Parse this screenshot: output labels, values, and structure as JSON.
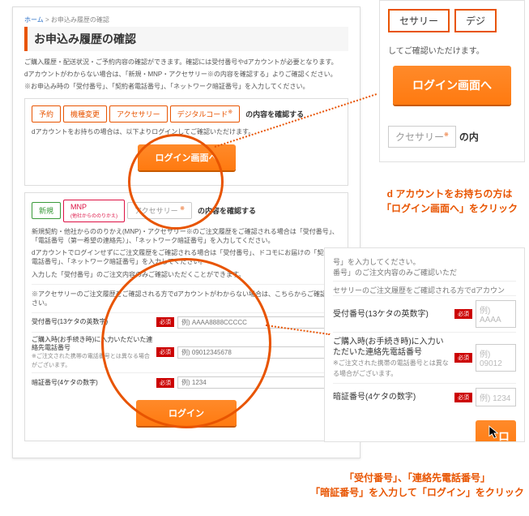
{
  "breadcrumb": {
    "home": "ホーム",
    "sep": " > ",
    "current": "お申込み履歴の確認"
  },
  "page_title": "お申込み履歴の確認",
  "desc1": "ご購入履歴・配送状況・ご予約内容の確認ができます。確認には受付番号やdアカウントが必要となります。",
  "desc2": "dアカウントがわからない場合は、「新規・MNP・アクセサリー※の内容を確認する」よりご確認ください。",
  "desc3": "※お申込み時の「受付番号」、「契約者電話番号」、「ネットワーク暗証番号」を入力してください。",
  "section1": {
    "tabs": [
      "予約",
      "機種変更",
      "アクセサリー",
      "デジタルコード"
    ],
    "tabs_suffix": "※",
    "tabs_label": "の内容を確認する",
    "note": "dアカウントをお持ちの場合は、以下よりログインしてご確認いただけます。",
    "btn": "ログイン画面へ"
  },
  "section2": {
    "tabs": [
      "新規",
      "MNP",
      "アクセサリー"
    ],
    "mnp_sub": "(他社からののりかえ)",
    "tabs_suffix": "※",
    "tabs_label": "の内容を確認する",
    "note1": "新規契約・他社からののりかえ(MNP)・アクセサリー※のご注文履歴をご確認される場合は「受付番号」、「電話番号（第一希望の連絡先）」、「ネットワーク暗証番号」を入力してください。",
    "note2": "dアカウントでログインせずにご注文履歴をご確認される場合は「受付番号」、ドコモにお届けの「契約者電話番号」、「ネットワーク暗証番号」を入力してください。",
    "note3": "入力した「受付番号」のご注文内容のみご確認いただくことができます。",
    "divider_note": "※アクセサリーのご注文履歴をご確認される方でdアカウントがわからない場合は、こちらからご確認ください。",
    "field1_label": "受付番号(13ケタの英数字)",
    "field1_ph": "例) AAAA8888CCCCC",
    "field2_label": "ご購入時(お手続き時)に入力いただいた連絡先電話番号",
    "field2_sub": "※ご注文された携帯の電話番号とは異なる場合がございます。",
    "field2_ph": "例) 09012345678",
    "field3_label": "暗証番号(4ケタの数字)",
    "field3_ph": "例) 1234",
    "req": "必須",
    "login_btn": "ログイン"
  },
  "zoom1": {
    "tab1": "セサリー",
    "tab2": "デジ",
    "note": "してご確認いただけます。",
    "btn": "ログイン画面へ",
    "lower_tab": "クセサリー",
    "lower_suffix": "※",
    "lower_label": "の内"
  },
  "caption1_l1": "d アカウントをお持ちの方は",
  "caption1_l2": "「ログイン画面へ」をクリック",
  "zoom2": {
    "top_frag1": "号」を入力してください。",
    "top_frag2": "番号」のご注文内容のみご確認いただ",
    "top_frag3": "セサリーのご注文履歴をご確認される方でdアカウン",
    "f1": "受付番号(13ケタの英数字)",
    "f1_ph": "例) AAAA",
    "f2": "ご購入時(お手続き時)に入力いただいた連絡先電話番号",
    "f2_sub": "※ご注文された携帯の電話番号とは異なる場合がございます。",
    "f2_ph": "例) 09012",
    "f3": "暗証番号(4ケタの数字)",
    "f3_ph": "例) 1234",
    "req": "必須",
    "btn": "ロ"
  },
  "caption2_l1": "「受付番号」、「連絡先電話番号」",
  "caption2_l2": "「暗証番号」を入力して「ログイン」をクリック"
}
